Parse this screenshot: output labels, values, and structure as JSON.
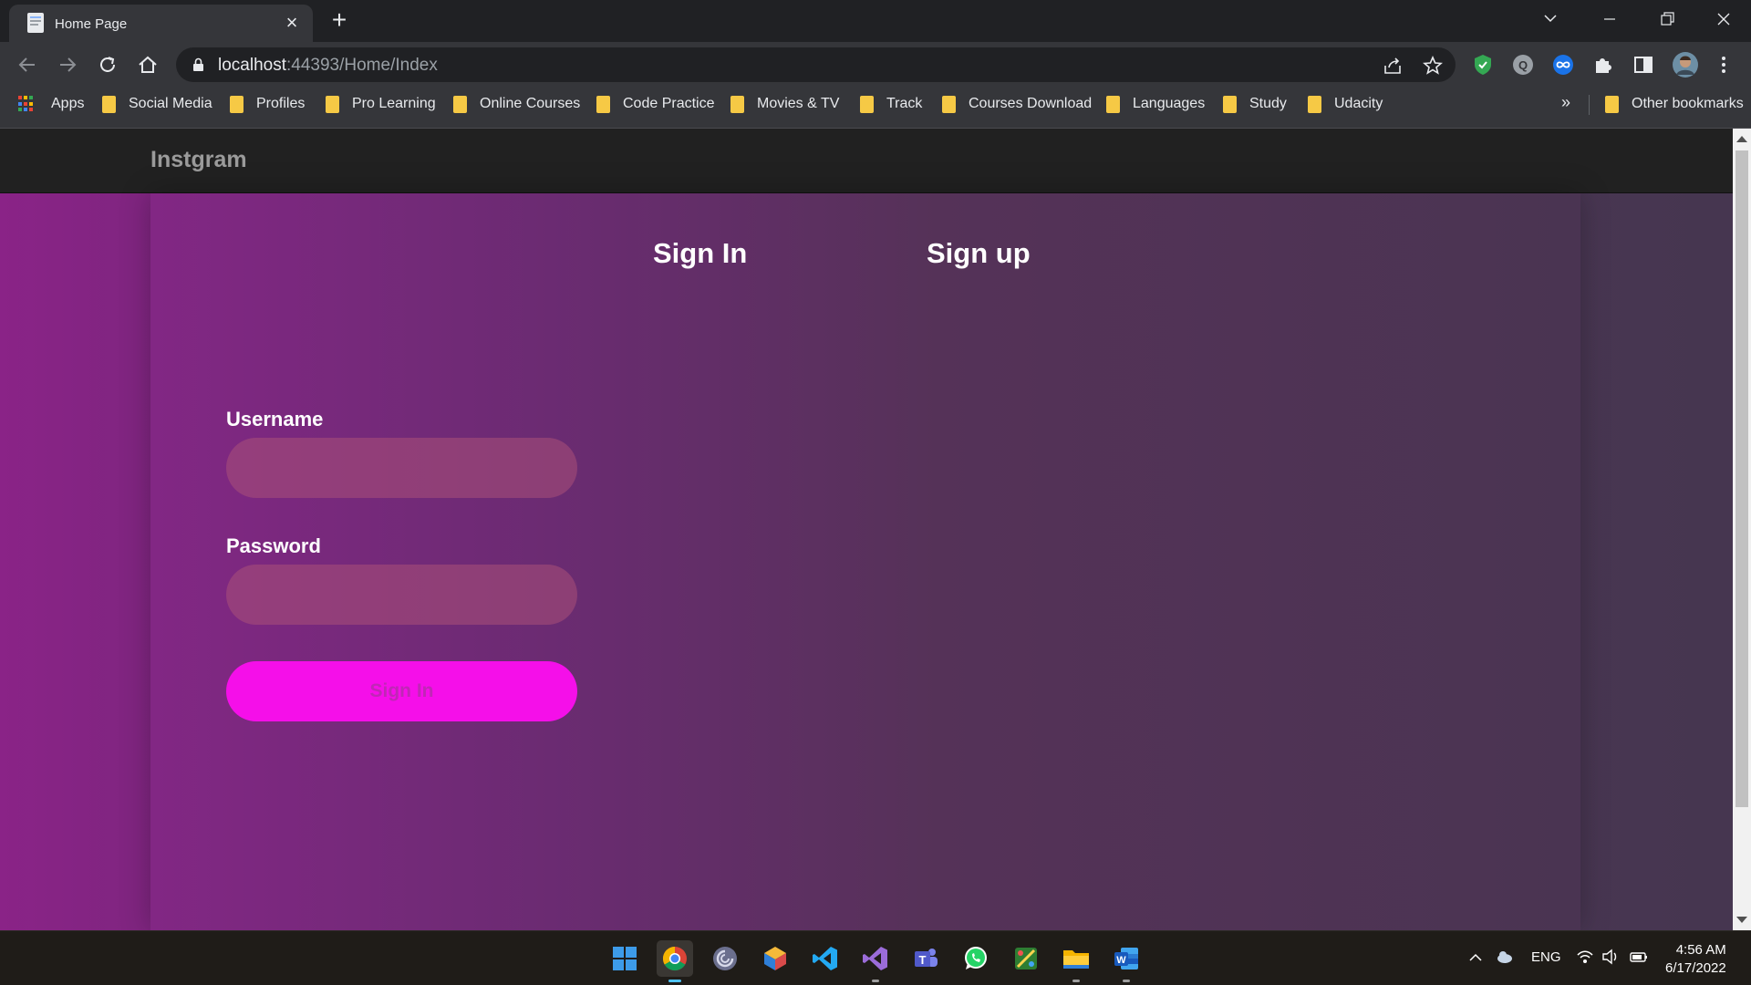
{
  "browser": {
    "tab_title": "Home Page",
    "url_host": "localhost",
    "url_rest": ":44393/Home/Index"
  },
  "bookmarks": {
    "apps_label": "Apps",
    "items": [
      "Social Media",
      "Profiles",
      "Pro Learning",
      "Online Courses",
      "Code Practice",
      "Movies & TV",
      "Track",
      "Courses Download",
      "Languages",
      "Study",
      "Udacity"
    ],
    "more": "»",
    "other": "Other bookmarks"
  },
  "page": {
    "brand": "Instgram",
    "tabs": {
      "signin": "Sign In",
      "signup": "Sign up"
    },
    "form": {
      "username_label": "Username",
      "username_value": "",
      "password_label": "Password",
      "password_value": "",
      "submit_label": "Sign In"
    }
  },
  "taskbar": {
    "language": "ENG",
    "time": "4:56 AM",
    "date": "6/17/2022"
  },
  "colors": {
    "submit_button": "#f50fe9",
    "background_left": "#8a2387",
    "background_right": "#463650"
  }
}
